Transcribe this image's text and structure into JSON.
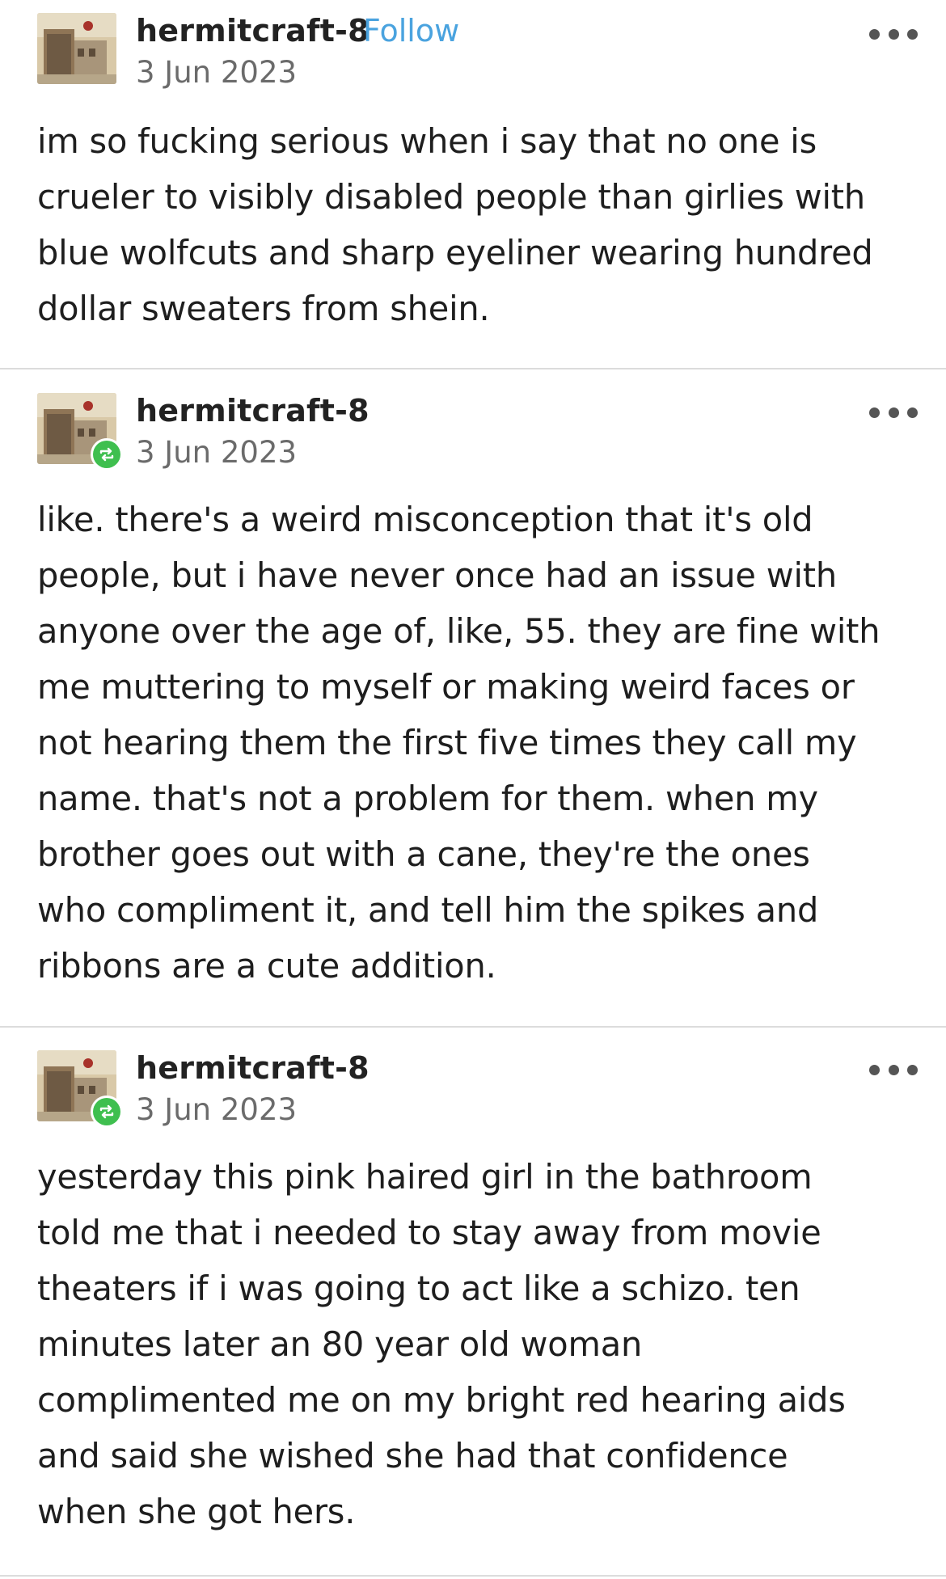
{
  "posts": [
    {
      "username": "hermitcraft-8",
      "follow_label": "Follow",
      "date": "3 Jun 2023",
      "reblogged": false,
      "text": "im so fucking serious when i say that no one is\ncrueler to visibly disabled people than girlies with\nblue wolfcuts and sharp eyeliner wearing hundred\ndollar sweaters from shein."
    },
    {
      "username": "hermitcraft-8",
      "date": "3 Jun 2023",
      "reblogged": true,
      "text": "like. there's a weird misconception that it's old\npeople, but i have never once had an issue with\nanyone over the age of, like, 55. they are fine with\nme muttering to myself or making weird faces or\nnot hearing them the first five times they call my\nname. that's not a problem for them. when my\nbrother goes out with a cane, they're the ones\nwho compliment it, and tell him the spikes and\nribbons are a cute addition."
    },
    {
      "username": "hermitcraft-8",
      "date": "3 Jun 2023",
      "reblogged": true,
      "text": "yesterday this pink haired girl in the bathroom\ntold me that i needed to stay away from movie\ntheaters if i was going to act like a schizo. ten\nminutes later an 80 year old woman\ncomplimented me on my bright red hearing aids\nand said she wished she had that confidence\nwhen she got hers."
    }
  ],
  "icons": {
    "avatar": "avatar-image",
    "reblog": "reblog-icon",
    "more": "more-options-icon"
  },
  "colors": {
    "follow": "#4aa3df",
    "reblog_badge": "#3fbf4f",
    "date": "#6b6b6b",
    "divider": "#dcdcdc"
  }
}
